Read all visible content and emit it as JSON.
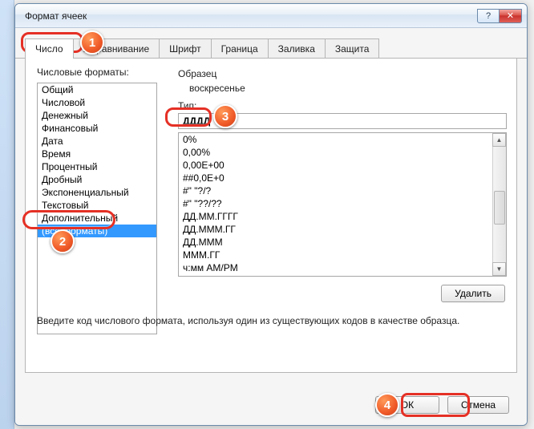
{
  "window": {
    "title": "Формат ячеек"
  },
  "winbuttons": {
    "help": "?",
    "close": "✕"
  },
  "tabs": [
    "Число",
    "Выравнивание",
    "Шрифт",
    "Граница",
    "Заливка",
    "Защита"
  ],
  "labels": {
    "categories": "Числовые форматы:",
    "sample": "Образец",
    "type": "Тип:",
    "instruction": "Введите код числового формата, используя один из существующих кодов в качестве образца."
  },
  "sample_value": "воскресенье",
  "type_value": "ДДДД",
  "categories": [
    "Общий",
    "Числовой",
    "Денежный",
    "Финансовый",
    "Дата",
    "Время",
    "Процентный",
    "Дробный",
    "Экспоненциальный",
    "Текстовый",
    "Дополнительный",
    "(все форматы)"
  ],
  "selected_category_index": 11,
  "format_codes": [
    "0%",
    "0,00%",
    "0,00E+00",
    "##0,0E+0",
    "#\" \"?/?",
    "#\" \"??/??",
    "ДД.ММ.ГГГГ",
    "ДД.МММ.ГГ",
    "ДД.МММ",
    "МММ.ГГ",
    "ч:мм AM/PM"
  ],
  "buttons": {
    "delete": "Удалить",
    "ok": "ОК",
    "cancel": "Отмена"
  },
  "badges": {
    "b1": "1",
    "b2": "2",
    "b3": "3",
    "b4": "4"
  }
}
